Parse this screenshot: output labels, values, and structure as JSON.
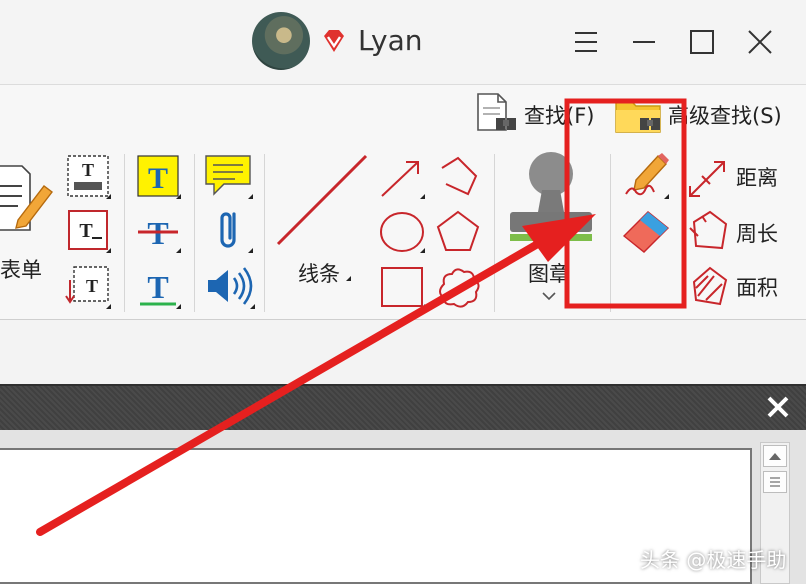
{
  "window": {
    "username": "Lyan",
    "controls": [
      "menu-icon",
      "minimize-icon",
      "maximize-icon",
      "close-icon"
    ]
  },
  "ribbon": {
    "find_label": "查找(F)",
    "advanced_find_label": "高级查找(S)",
    "form_label": "表单",
    "line_label": "线条",
    "stamp_label": "图章",
    "distance_label": "距离",
    "perimeter_label": "周长",
    "area_label": "面积"
  },
  "colors": {
    "annotation_red": "#e5201f",
    "highlight_yellow": "#fff200",
    "shape_red": "#c8262b"
  },
  "watermark": "头条 @极速手助"
}
